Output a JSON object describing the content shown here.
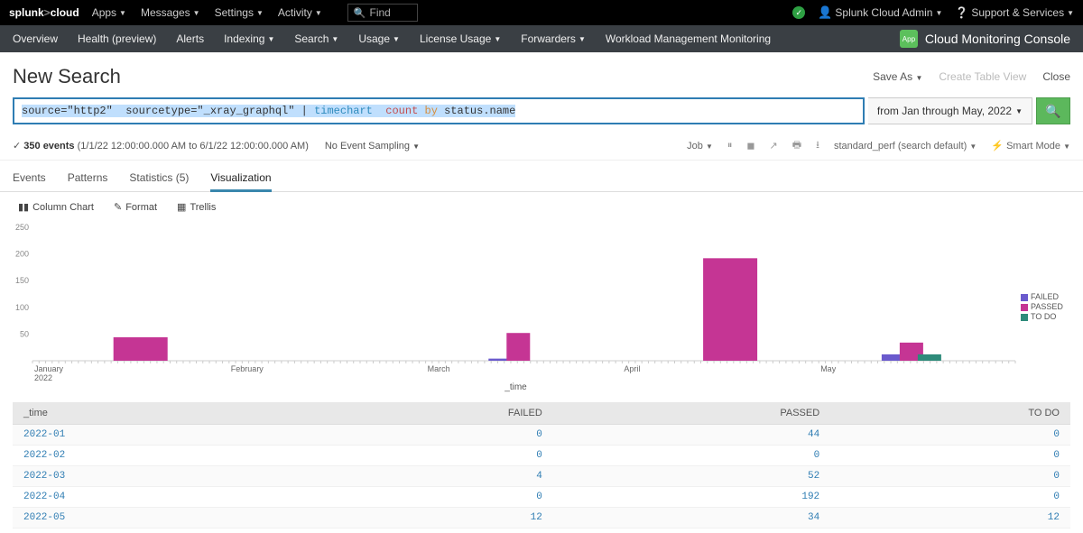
{
  "topbar": {
    "brand_left": "splunk",
    "brand_right": "cloud",
    "menus": [
      "Apps",
      "Messages",
      "Settings",
      "Activity"
    ],
    "find_placeholder": "Find",
    "user": "Splunk Cloud Admin",
    "support": "Support & Services"
  },
  "navbar": {
    "items": [
      "Overview",
      "Health (preview)",
      "Alerts",
      "Indexing",
      "Search",
      "Usage",
      "License Usage",
      "Forwarders",
      "Workload Management Monitoring"
    ],
    "caret_items": [
      false,
      false,
      false,
      true,
      true,
      true,
      true,
      true,
      false
    ],
    "app_label": "App",
    "console": "Cloud Monitoring Console"
  },
  "header": {
    "title": "New Search",
    "save_as": "Save As",
    "create_table": "Create Table View",
    "close": "Close"
  },
  "search": {
    "raw": "source=\"http2\"  sourcetype=\"_xray_graphql\" | timechart  count by status.name",
    "time_label": "from Jan through May, 2022"
  },
  "status": {
    "check": "✓",
    "count": "350 events",
    "range": "(1/1/22 12:00:00.000 AM to 6/1/22 12:00:00.000 AM)",
    "sampling": "No Event Sampling",
    "job": "Job",
    "format": "standard_perf (search default)",
    "mode": "Smart Mode"
  },
  "tabs": {
    "events": "Events",
    "patterns": "Patterns",
    "stats": "Statistics (5)",
    "vis": "Visualization"
  },
  "vis_toolbar": {
    "chart_type": "Column Chart",
    "format": "Format",
    "trellis": "Trellis"
  },
  "chart_data": {
    "type": "bar",
    "title": "",
    "xlabel": "_time",
    "ylabel": "",
    "ylim": [
      0,
      250
    ],
    "yticks": [
      50,
      100,
      150,
      200,
      250
    ],
    "categories": [
      "January",
      "February",
      "March",
      "April",
      "May"
    ],
    "year_label": "2022",
    "series": [
      {
        "name": "FAILED",
        "color": "#6a5acd",
        "values": [
          0,
          0,
          4,
          0,
          12
        ]
      },
      {
        "name": "PASSED",
        "color": "#c53594",
        "values": [
          44,
          0,
          52,
          192,
          34
        ]
      },
      {
        "name": "TO DO",
        "color": "#2e8b7a",
        "values": [
          0,
          0,
          0,
          0,
          12
        ]
      }
    ]
  },
  "table": {
    "columns": [
      "_time",
      "FAILED",
      "PASSED",
      "TO DO"
    ],
    "rows": [
      {
        "_time": "2022-01",
        "FAILED": 0,
        "PASSED": 44,
        "TO DO": 0
      },
      {
        "_time": "2022-02",
        "FAILED": 0,
        "PASSED": 0,
        "TO DO": 0
      },
      {
        "_time": "2022-03",
        "FAILED": 4,
        "PASSED": 52,
        "TO DO": 0
      },
      {
        "_time": "2022-04",
        "FAILED": 0,
        "PASSED": 192,
        "TO DO": 0
      },
      {
        "_time": "2022-05",
        "FAILED": 12,
        "PASSED": 34,
        "TO DO": 12
      }
    ]
  }
}
